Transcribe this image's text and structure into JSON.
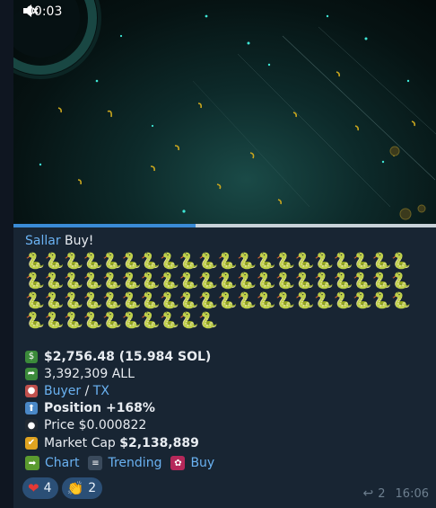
{
  "video": {
    "timecode": "00:03",
    "progress": 0.43
  },
  "message": {
    "sender": "Sallar",
    "action": "Buy!",
    "snakes_line1": "🐍🐍🐍🐍🐍🐍🐍🐍🐍🐍🐍🐍🐍🐍🐍🐍🐍🐍🐍🐍",
    "snakes_line2": "🐍🐍🐍🐍🐍🐍🐍🐍🐍🐍🐍🐍🐍🐍🐍🐍🐍🐍🐍🐍",
    "snakes_line3": "🐍🐍🐍🐍🐍🐍🐍🐍🐍🐍🐍🐍🐍🐍🐍🐍🐍🐍🐍🐍",
    "snakes_line4": "🐍🐍🐍🐍🐍🐍🐍🐍🐍🐍",
    "stats": {
      "usd": "$2,756.48 (15.984 SOL)",
      "amount": "3,392,309 ALL",
      "buyer": "Buyer",
      "sep": " / ",
      "tx": "TX",
      "position": "Position +168%",
      "price": "Price $0.000822",
      "mcap_label": "Market Cap ",
      "mcap_value": "$2,138,889"
    },
    "actions": {
      "chart": "Chart",
      "trending": "Trending",
      "buy": "Buy"
    },
    "reactions": {
      "heart_count": "4",
      "clap_count": "2"
    },
    "replies": "2",
    "time": "16:06"
  },
  "colors": {
    "link": "#6ab2f2",
    "bubble": "#182533",
    "reaction_bg": "#2b4f76"
  }
}
